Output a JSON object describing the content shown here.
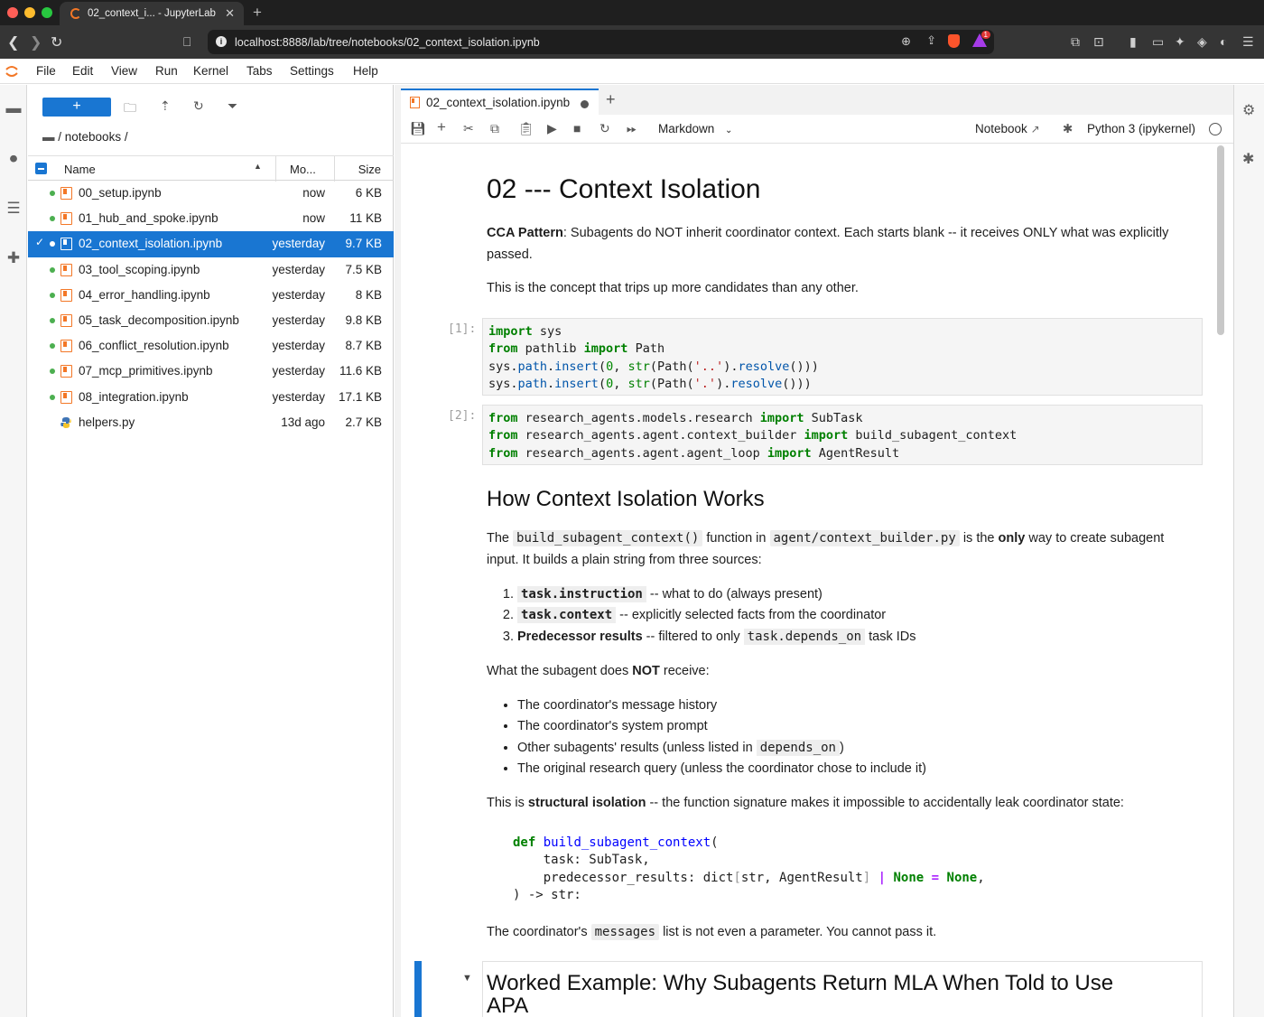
{
  "browser": {
    "tab_title": "02_context_i... - JupyterLab",
    "url": "localhost:8888/lab/tree/notebooks/02_context_isolation.ipynb",
    "notification_count": "1"
  },
  "menubar": [
    "File",
    "Edit",
    "View",
    "Run",
    "Kernel",
    "Tabs",
    "Settings",
    "Help"
  ],
  "filebrowser": {
    "new_label": "+",
    "breadcrumb": "/ notebooks /",
    "columns": {
      "name": "Name",
      "modified": "Mo...",
      "size": "Size"
    },
    "files": [
      {
        "name": "00_setup.ipynb",
        "modified": "now",
        "size": "6 KB",
        "type": "notebook",
        "running": true,
        "selected": false
      },
      {
        "name": "01_hub_and_spoke.ipynb",
        "modified": "now",
        "size": "11 KB",
        "type": "notebook",
        "running": true,
        "selected": false
      },
      {
        "name": "02_context_isolation.ipynb",
        "modified": "yesterday",
        "size": "9.7 KB",
        "type": "notebook",
        "running": true,
        "selected": true
      },
      {
        "name": "03_tool_scoping.ipynb",
        "modified": "yesterday",
        "size": "7.5 KB",
        "type": "notebook",
        "running": true,
        "selected": false
      },
      {
        "name": "04_error_handling.ipynb",
        "modified": "yesterday",
        "size": "8 KB",
        "type": "notebook",
        "running": true,
        "selected": false
      },
      {
        "name": "05_task_decomposition.ipynb",
        "modified": "yesterday",
        "size": "9.8 KB",
        "type": "notebook",
        "running": true,
        "selected": false
      },
      {
        "name": "06_conflict_resolution.ipynb",
        "modified": "yesterday",
        "size": "8.7 KB",
        "type": "notebook",
        "running": true,
        "selected": false
      },
      {
        "name": "07_mcp_primitives.ipynb",
        "modified": "yesterday",
        "size": "11.6 KB",
        "type": "notebook",
        "running": true,
        "selected": false
      },
      {
        "name": "08_integration.ipynb",
        "modified": "yesterday",
        "size": "17.1 KB",
        "type": "notebook",
        "running": true,
        "selected": false
      },
      {
        "name": "helpers.py",
        "modified": "13d ago",
        "size": "2.7 KB",
        "type": "python",
        "running": false,
        "selected": false
      }
    ]
  },
  "notebook": {
    "tab_label": "02_context_isolation.ipynb",
    "cell_type": "Markdown",
    "notebook_link": "Notebook",
    "kernel": "Python 3 (ipykernel)",
    "title": "02 --- Context Isolation",
    "p1_bold": "CCA Pattern",
    "p1_text": ": Subagents do NOT inherit coordinator context. Each starts blank -- it receives ONLY what was explicitly passed.",
    "p2": "This is the concept that trips up more candidates than any other.",
    "cell1_prompt": "[1]:",
    "cell2_prompt": "[2]:",
    "h2": "How Context Isolation Works",
    "p3_a": "The",
    "p3_code1": "build_subagent_context()",
    "p3_b": "function in",
    "p3_code2": "agent/context_builder.py",
    "p3_c": "is the",
    "p3_bold": "only",
    "p3_d": "way to create subagent input. It builds a plain string from three sources:",
    "ol": [
      {
        "code": "task.instruction",
        "text": " -- what to do (always present)"
      },
      {
        "code": "task.context",
        "text": " -- explicitly selected facts from the coordinator"
      },
      {
        "bold": "Predecessor results",
        "text_a": " -- filtered to only ",
        "code": "task.depends_on",
        "text_b": " task IDs"
      }
    ],
    "p4_a": "What the subagent does ",
    "p4_bold": "NOT",
    "p4_b": " receive:",
    "ul": [
      "The coordinator's message history",
      "The coordinator's system prompt",
      "Other subagents' results (unless listed in ",
      "The original research query (unless the coordinator chose to include it)"
    ],
    "ul_code": "depends_on",
    "ul_close": ")",
    "p5_a": "This is ",
    "p5_bold": "structural isolation",
    "p5_b": " -- the function signature makes it impossible to accidentally leak coordinator state:",
    "p6_a": "The coordinator's ",
    "p6_code": "messages",
    "p6_b": " list is not even a parameter. You cannot pass it.",
    "h2b": "Worked Example: Why Subagents Return MLA When Told to Use APA"
  }
}
